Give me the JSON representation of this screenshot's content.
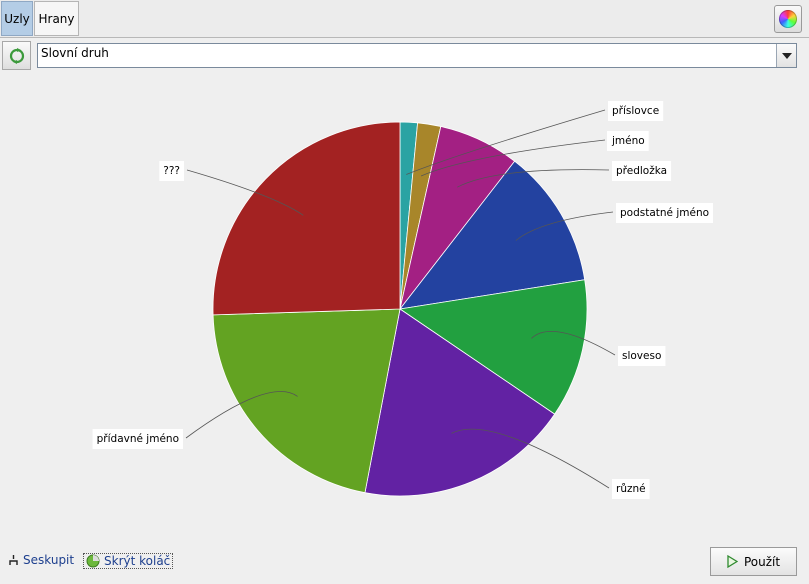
{
  "tabs": [
    {
      "label": "Uzly",
      "active": true
    },
    {
      "label": "Hrany",
      "active": false
    }
  ],
  "toolbar": {
    "color_icon": "color-wheel-icon",
    "refresh_icon": "refresh-icon"
  },
  "select": {
    "value": "Slovní druh"
  },
  "chart_data": {
    "type": "pie",
    "title": "",
    "slices": [
      {
        "label": "příslovce",
        "value": 1.5,
        "color": "#2aa3a3"
      },
      {
        "label": "jméno",
        "value": 2.0,
        "color": "#a8862a"
      },
      {
        "label": "předložka",
        "value": 7.0,
        "color": "#a32083"
      },
      {
        "label": "podstatné jméno",
        "value": 12.0,
        "color": "#2342a0"
      },
      {
        "label": "sloveso",
        "value": 12.0,
        "color": "#22a040"
      },
      {
        "label": "různé",
        "value": 18.5,
        "color": "#6222a3"
      },
      {
        "label": "přídavné jméno",
        "value": 21.5,
        "color": "#63a322"
      },
      {
        "label": "???",
        "value": 25.5,
        "color": "#a32222"
      }
    ]
  },
  "bottom": {
    "group_label": "Seskupit",
    "hide_label": "Skrýt koláč",
    "apply_label": "Použít"
  }
}
